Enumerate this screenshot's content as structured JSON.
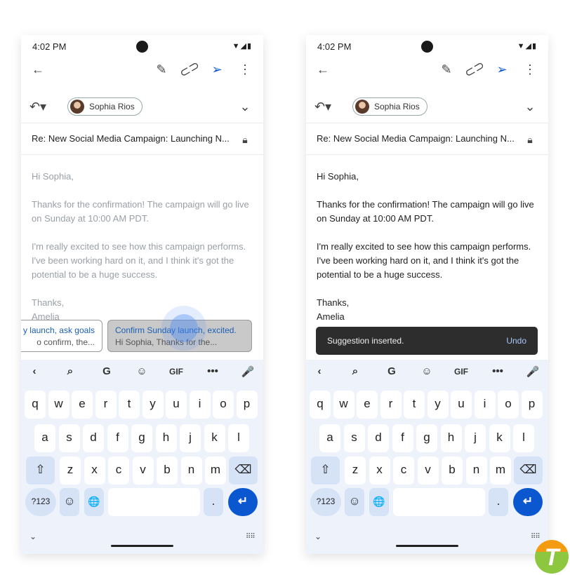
{
  "phones": [
    {
      "status": {
        "time": "4:02 PM"
      },
      "recipient": "Sophia Rios",
      "subject": "Re: New Social Media Campaign: Launching N...",
      "body": [
        "Hi Sophia,",
        "Thanks for the confirmation! The campaign will go live on Sunday at 10:00 AM PDT.",
        "I'm really excited to see how this campaign performs. I've been working hard on it, and I think it's got the potential to be a huge success.",
        "Thanks,",
        "Amelia"
      ],
      "body_color": "#9aa0a6",
      "suggestions": [
        {
          "title": "y launch, ask goals",
          "preview": "o confirm, the...",
          "selected": false
        },
        {
          "title": "Confirm Sunday launch, excited.",
          "preview": "Hi Sophia, Thanks for the...",
          "selected": true
        }
      ]
    },
    {
      "status": {
        "time": "4:02 PM"
      },
      "recipient": "Sophia Rios",
      "subject": "Re: New Social Media Campaign: Launching N...",
      "body": [
        "Hi Sophia,",
        "Thanks for the confirmation! The campaign will go live on Sunday at 10:00 AM PDT.",
        "I'm really excited to see how this campaign performs. I've been working hard on it, and I think it's got the potential to be a huge success.",
        "Thanks,",
        "Amelia"
      ],
      "body_color": "#1f1f1f",
      "snackbar": {
        "message": "Suggestion inserted.",
        "action": "Undo"
      }
    }
  ],
  "keyboard": {
    "toolbar": [
      "‹",
      "⌕",
      "G",
      "☺",
      "GIF",
      "•••",
      "🎤"
    ],
    "row1": [
      "q",
      "w",
      "e",
      "r",
      "t",
      "y",
      "u",
      "i",
      "o",
      "p"
    ],
    "row2": [
      "a",
      "s",
      "d",
      "f",
      "g",
      "h",
      "j",
      "k",
      "l"
    ],
    "row3": [
      "z",
      "x",
      "c",
      "v",
      "b",
      "n",
      "m"
    ],
    "symbols": "?123",
    "period": ".",
    "emoji": "☺",
    "shift": "⇧",
    "backspace": "⌫",
    "globe": "🌐",
    "enter": "↵"
  },
  "colors": {
    "accent": "#0b57d0",
    "suggestion_title": "#1a5fb4"
  }
}
